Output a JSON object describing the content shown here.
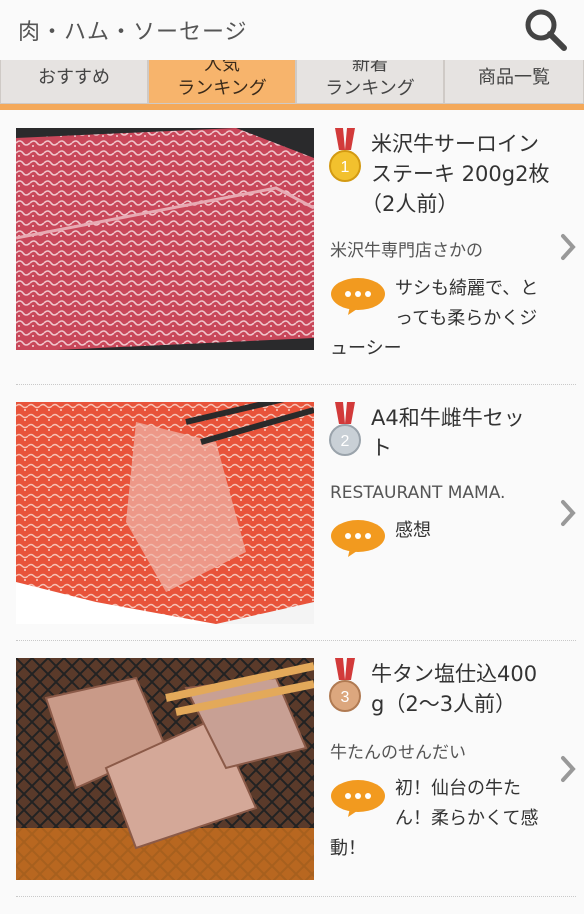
{
  "header": {
    "title": "肉・ハム・ソーセージ",
    "search_icon": "search-icon"
  },
  "tabs": [
    {
      "label": "おすすめ",
      "active": false
    },
    {
      "label_top": "人気",
      "label": "ランキング",
      "active": true
    },
    {
      "label_top": "新着",
      "label": "ランキング",
      "active": false
    },
    {
      "label": "商品一覧",
      "active": false
    }
  ],
  "colors": {
    "accent": "#f4a95a",
    "active_tab": "#f7b46c",
    "bubble": "#f29a1f",
    "gold": "#f2c12e",
    "silver": "#b8c0c8",
    "bronze": "#d9a37a"
  },
  "items": [
    {
      "rank": "1",
      "name_lines": [
        "米沢牛サーロイン",
        "ステーキ 200g2枚",
        "（2人前）"
      ],
      "shop": "米沢牛専門店さかの",
      "comment_lines": [
        "サシも綺麗で、と",
        "っても柔らかくジ",
        "ューシー"
      ],
      "photo": "sirloin-steak-photo"
    },
    {
      "rank": "2",
      "name_lines": [
        "A4和牛雌牛セッ",
        "ト"
      ],
      "shop": "RESTAURANT MAMA.",
      "comment_lines": [
        "感想"
      ],
      "photo": "wagyu-set-photo"
    },
    {
      "rank": "3",
      "name_lines": [
        "牛タン塩仕込400",
        "g（2〜3人前）"
      ],
      "shop": "牛たんのせんだい",
      "comment_lines": [
        "初！仙台の牛た",
        "ん！柔らかくて感",
        "動！"
      ],
      "photo": "beef-tongue-photo"
    }
  ]
}
